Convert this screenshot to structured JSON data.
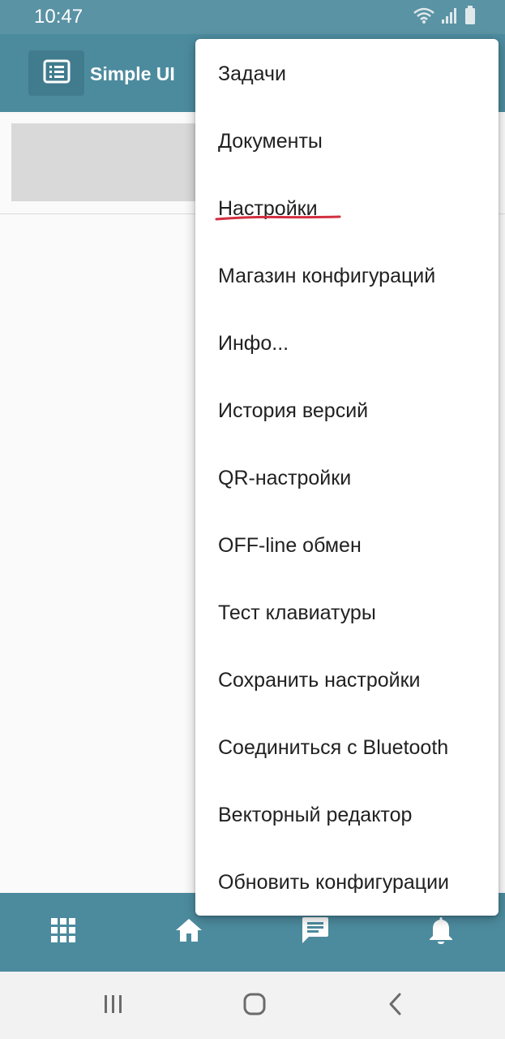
{
  "status_bar": {
    "time": "10:47"
  },
  "app_bar": {
    "title": "Simple UI"
  },
  "menu": {
    "items": [
      "Задачи",
      "Документы",
      "Настройки",
      "Магазин конфигураций",
      "Инфо...",
      "История версий",
      "QR-настройки",
      "OFF-line обмен",
      "Тест клавиатуры",
      "Сохранить настройки",
      "Соединиться с Bluetooth",
      "Векторный редактор",
      "Обновить конфигурации"
    ],
    "highlighted_item": "Настройки",
    "annotation_color": "#d32f3f"
  },
  "bottom_nav": {
    "icons": [
      "apps-grid-icon",
      "home-icon",
      "chat-icon",
      "bell-icon"
    ]
  },
  "system_nav": {
    "icons": [
      "recents-icon",
      "home-circle-icon",
      "back-icon"
    ]
  },
  "colors": {
    "app_bar": "#4c8b9e",
    "status_bar": "#5a93a4",
    "background": "#fafafa",
    "menu_background": "#ffffff",
    "card_placeholder": "#d9d9d9"
  }
}
